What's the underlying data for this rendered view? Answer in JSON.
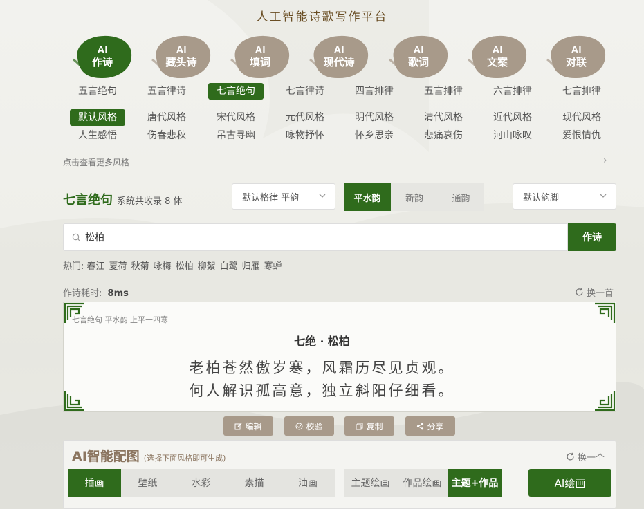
{
  "site_title": "人工智能诗歌写作平台",
  "colors": {
    "accent": "#2f6b1c",
    "muted": "#a89a8a",
    "brown": "#8b7560"
  },
  "categories": [
    {
      "l1": "AI",
      "l2": "作诗",
      "active": true
    },
    {
      "l1": "AI",
      "l2": "藏头诗",
      "active": false
    },
    {
      "l1": "AI",
      "l2": "填词",
      "active": false
    },
    {
      "l1": "AI",
      "l2": "现代诗",
      "active": false
    },
    {
      "l1": "AI",
      "l2": "歌词",
      "active": false
    },
    {
      "l1": "AI",
      "l2": "文案",
      "active": false
    },
    {
      "l1": "AI",
      "l2": "对联",
      "active": false
    }
  ],
  "forms": [
    "五言绝句",
    "五言律诗",
    "七言绝句",
    "七言律诗",
    "四言排律",
    "五言排律",
    "六言排律",
    "七言排律"
  ],
  "forms_active": 2,
  "styles_row1": [
    "默认风格",
    "唐代风格",
    "宋代风格",
    "元代风格",
    "明代风格",
    "清代风格",
    "近代风格",
    "现代风格"
  ],
  "styles_row2": [
    "人生感悟",
    "伤春悲秋",
    "吊古寻幽",
    "咏物抒怀",
    "怀乡思亲",
    "悲痛哀伤",
    "河山咏叹",
    "爱恨情仇"
  ],
  "more_styles": "点击查看更多风格",
  "form_header": {
    "title": "七言绝句",
    "count": "系统共收录 8 体"
  },
  "select_meter": "默认格律 平韵",
  "rhyme_tabs": [
    "平水韵",
    "新韵",
    "通韵"
  ],
  "select_foot": "默认韵脚",
  "search": {
    "value": "松柏",
    "button": "作诗"
  },
  "hot": {
    "label": "热门:",
    "items": [
      "春江",
      "夏荷",
      "秋菊",
      "咏梅",
      "松柏",
      "柳絮",
      "白鹭",
      "归雁",
      "寒蝉"
    ]
  },
  "timing": {
    "label": "作诗耗时:",
    "value": "8ms"
  },
  "refresh": "换一首",
  "poem": {
    "meta": "七言绝句 平水韵 上平十四寒",
    "title": "七绝 · 松柏",
    "lines": [
      "老柏苍然傲岁寒，风霜历尽见贞观。",
      "何人解识孤高意，独立斜阳仔细看。"
    ]
  },
  "actions": [
    "编辑",
    "校验",
    "复制",
    "分享"
  ],
  "ai_image": {
    "title": "AI智能配图",
    "tip": "(选择下面风格即可生成)",
    "refresh": "换一个",
    "styles": [
      "插画",
      "壁纸",
      "水彩",
      "素描",
      "油画"
    ],
    "modes": [
      "主题绘画",
      "作品绘画",
      "主题+作品"
    ],
    "button": "AI绘画"
  }
}
